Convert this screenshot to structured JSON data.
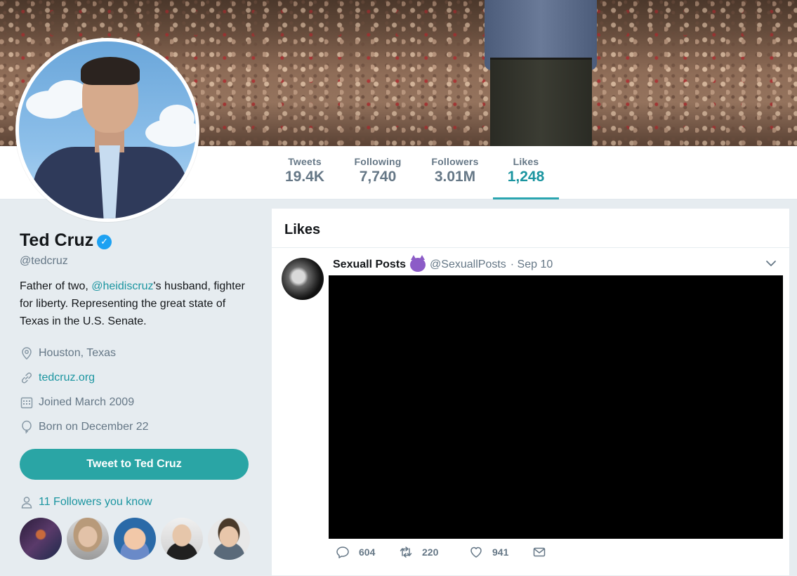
{
  "profile": {
    "name": "Ted Cruz",
    "handle": "@tedcruz",
    "bio_before": "Father of two, ",
    "bio_mention": "@heidiscruz",
    "bio_after": "'s husband, fighter for liberty. Representing the great state of Texas in the U.S. Senate.",
    "location": "Houston, Texas",
    "website": "tedcruz.org",
    "joined": "Joined March 2009",
    "born": "Born on December 22",
    "tweet_to_label": "Tweet to Ted Cruz",
    "followers_you_know": "11 Followers you know"
  },
  "nav": {
    "stats": [
      {
        "label": "Tweets",
        "value": "19.4K"
      },
      {
        "label": "Following",
        "value": "7,740"
      },
      {
        "label": "Followers",
        "value": "3.01M"
      },
      {
        "label": "Likes",
        "value": "1,248"
      }
    ]
  },
  "timeline": {
    "title": "Likes",
    "tweet": {
      "name": "Sexuall Posts",
      "emoji": "smiling-devil-emoji",
      "handle": "@SexuallPosts",
      "time": "· Sep 10",
      "replies": "604",
      "retweets": "220",
      "likes": "941"
    }
  },
  "colors": {
    "accent": "#1b95a0",
    "button": "#2aa5a5",
    "verified": "#1da1f2",
    "background": "#e6ecf0"
  }
}
